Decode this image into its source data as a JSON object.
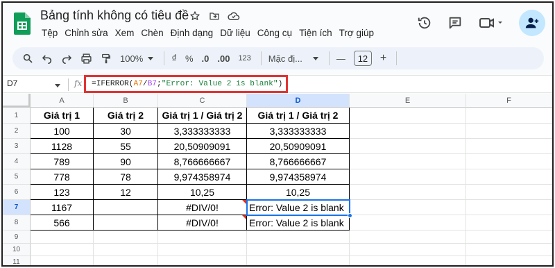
{
  "app": {
    "title": "Bảng tính không có tiêu đề",
    "menu": [
      "Tệp",
      "Chỉnh sửa",
      "Xem",
      "Chèn",
      "Định dạng",
      "Dữ liệu",
      "Công cụ",
      "Tiện ích",
      "Trợ giúp"
    ]
  },
  "toolbar": {
    "zoom": "100%",
    "currency": "₫",
    "percent": "%",
    "decrease_decimal": ".0",
    "increase_decimal": ".00",
    "number_format": "123",
    "font": "Mặc đị...",
    "font_size": "12",
    "minus": "—",
    "plus": "+"
  },
  "formula_bar": {
    "name_box": "D7",
    "fx": "fx",
    "parts": {
      "prefix": "=IFERROR(",
      "ref_a": "A7",
      "slash": "/",
      "ref_b": "B7",
      "semi": ";",
      "string": "\"Error: Value 2 is blank\"",
      "suffix": ")"
    }
  },
  "grid": {
    "columns": [
      "A",
      "B",
      "C",
      "D",
      "E",
      "F"
    ],
    "selected_column": "D",
    "rows": [
      "1",
      "2",
      "3",
      "4",
      "5",
      "6",
      "7",
      "8",
      "9",
      "10",
      "11"
    ],
    "selected_row": "7",
    "headers": [
      "Giá trị 1",
      "Giá trị 2",
      "Giá trị 1 / Giá trị 2",
      "Giá trị 1 / Giá trị 2"
    ],
    "data": [
      [
        "100",
        "30",
        "3,333333333",
        "3,333333333"
      ],
      [
        "1128",
        "55",
        "20,50909091",
        "20,50909091"
      ],
      [
        "789",
        "90",
        "8,766666667",
        "8,766666667"
      ],
      [
        "778",
        "78",
        "9,974358974",
        "9,974358974"
      ],
      [
        "123",
        "12",
        "10,25",
        "10,25"
      ],
      [
        "1167",
        "",
        "#DIV/0!",
        "Error: Value 2 is blank"
      ],
      [
        "566",
        "",
        "#DIV/0!",
        "Error: Value 2 is blank"
      ]
    ]
  },
  "colors": {
    "accent": "#1a73e8",
    "highlight_box": "#e03535",
    "sheets_green": "#0f9d58"
  }
}
